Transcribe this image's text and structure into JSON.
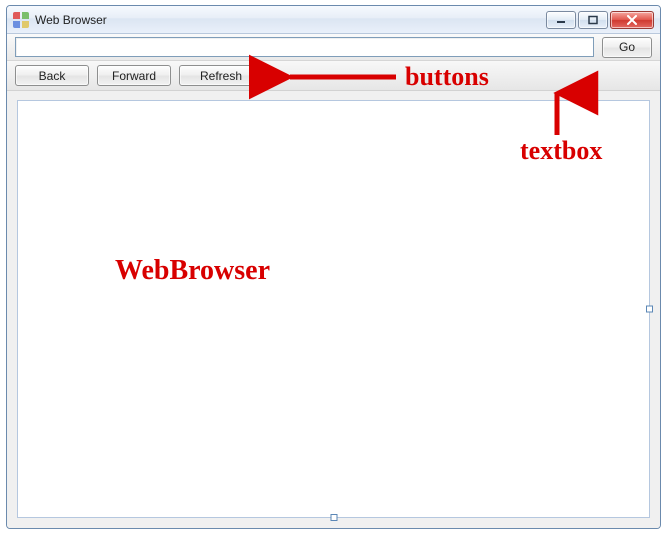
{
  "window": {
    "title": "Web Browser"
  },
  "toolbar": {
    "go_label": "Go",
    "url_value": ""
  },
  "nav": {
    "back_label": "Back",
    "forward_label": "Forward",
    "refresh_label": "Refresh"
  },
  "annotations": {
    "buttons_label": "buttons",
    "textbox_label": "textbox",
    "webbrowser_label": "WebBrowser"
  }
}
